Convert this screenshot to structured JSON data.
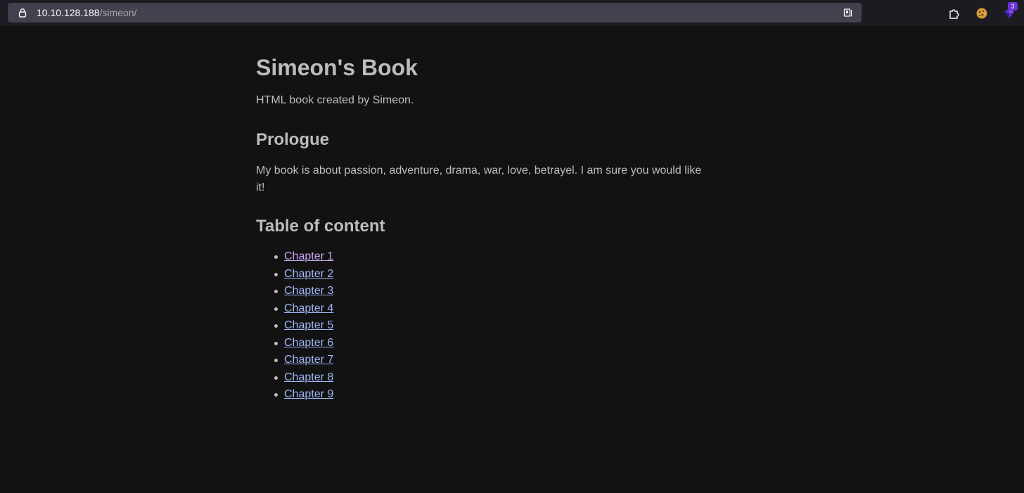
{
  "browser": {
    "url_host": "10.10.128.188",
    "url_path": "/simeon/",
    "extensions": [
      {
        "icon": "puzzle-icon"
      },
      {
        "icon": "cookie-icon"
      },
      {
        "icon": "gem-icon",
        "badge": "3"
      }
    ]
  },
  "page": {
    "title": "Simeon's Book",
    "subtitle": "HTML book created by Simeon.",
    "prologue_heading": "Prologue",
    "prologue_text": "My book is about passion, adventure, drama, war, love, betrayel. I am sure you would like it!",
    "toc_heading": "Table of content",
    "chapters": [
      {
        "label": "Chapter 1",
        "visited": true
      },
      {
        "label": "Chapter 2",
        "visited": false
      },
      {
        "label": "Chapter 3",
        "visited": false
      },
      {
        "label": "Chapter 4",
        "visited": false
      },
      {
        "label": "Chapter 5",
        "visited": false
      },
      {
        "label": "Chapter 6",
        "visited": false
      },
      {
        "label": "Chapter 7",
        "visited": false
      },
      {
        "label": "Chapter 8",
        "visited": false
      },
      {
        "label": "Chapter 9",
        "visited": false
      }
    ]
  },
  "colors": {
    "background": "#121212",
    "text": "#bdbdbd",
    "link": "#9eb6f5",
    "link_visited": "#c9a6f0"
  }
}
